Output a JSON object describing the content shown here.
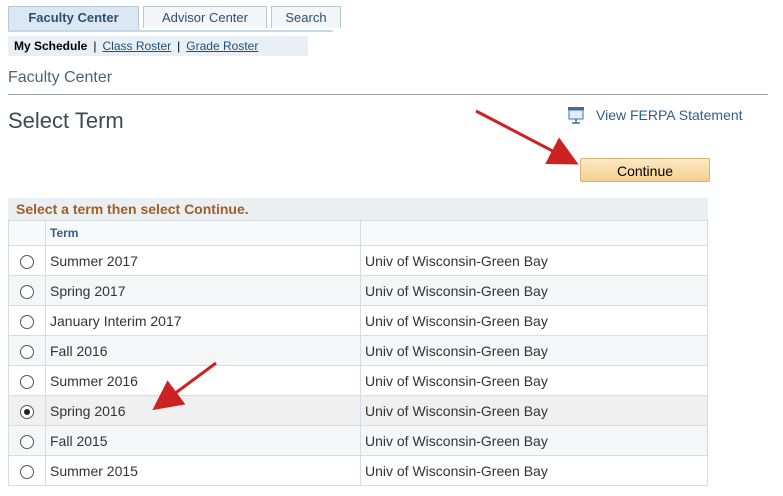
{
  "tabs": [
    {
      "label": "Faculty Center",
      "active": true
    },
    {
      "label": "Advisor Center",
      "active": false
    },
    {
      "label": "Search",
      "active": false
    }
  ],
  "subnav": {
    "current": "My Schedule",
    "links": [
      "Class Roster",
      "Grade Roster"
    ],
    "separator": "|"
  },
  "breadcrumb_title": "Faculty Center",
  "page_title": "Select Term",
  "ferpa_link": "View FERPA Statement",
  "continue_button": "Continue",
  "grid": {
    "header": "Select a term then select Continue.",
    "column_term": "Term",
    "column_institution": "",
    "rows": [
      {
        "term": "Summer 2017",
        "institution": "Univ of Wisconsin-Green Bay",
        "selected": false
      },
      {
        "term": "Spring 2017",
        "institution": "Univ of Wisconsin-Green Bay",
        "selected": false
      },
      {
        "term": "January Interim 2017",
        "institution": "Univ of Wisconsin-Green Bay",
        "selected": false
      },
      {
        "term": "Fall 2016",
        "institution": "Univ of Wisconsin-Green Bay",
        "selected": false
      },
      {
        "term": "Summer 2016",
        "institution": "Univ of Wisconsin-Green Bay",
        "selected": false
      },
      {
        "term": "Spring 2016",
        "institution": "Univ of Wisconsin-Green Bay",
        "selected": true
      },
      {
        "term": "Fall 2015",
        "institution": "Univ of Wisconsin-Green Bay",
        "selected": false
      },
      {
        "term": "Summer 2015",
        "institution": "Univ of Wisconsin-Green Bay",
        "selected": false
      }
    ]
  },
  "icons": {
    "ferpa": "presentation-board-icon",
    "annotation": "red-arrow-icon"
  },
  "colors": {
    "accent_orange": "#a35c25",
    "link_blue": "#2f5e92",
    "arrow_red": "#cc2222",
    "button_bg": "#f7cf8f"
  }
}
